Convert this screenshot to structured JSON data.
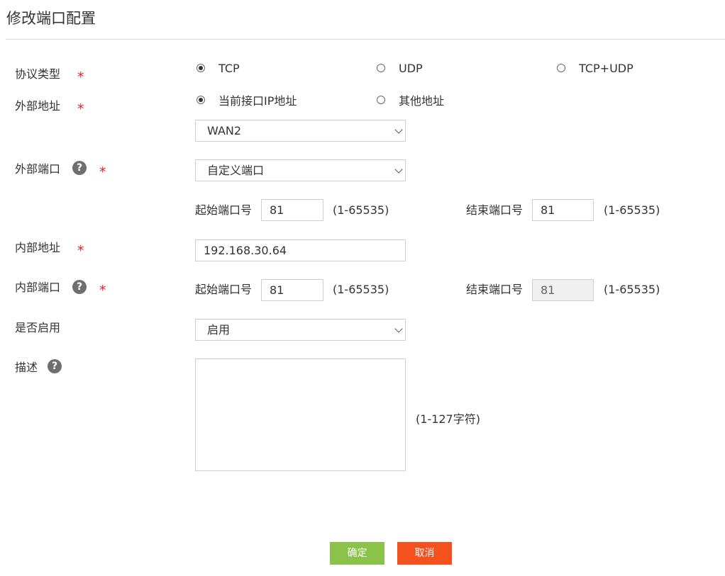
{
  "page_title": "修改端口配置",
  "required_mark": "*",
  "help_glyph": "?",
  "protocol": {
    "label": "协议类型",
    "options": [
      {
        "label": "TCP",
        "selected": true
      },
      {
        "label": "UDP",
        "selected": false
      },
      {
        "label": "TCP+UDP",
        "selected": false
      }
    ]
  },
  "external_address": {
    "label": "外部地址",
    "options": [
      {
        "label": "当前接口IP地址",
        "selected": true
      },
      {
        "label": "其他地址",
        "selected": false
      }
    ],
    "interface_select": "WAN2"
  },
  "external_port": {
    "label": "外部端口",
    "mode_select": "自定义端口",
    "start_label": "起始端口号",
    "start_value": "81",
    "start_range": "(1-65535)",
    "end_label": "结束端口号",
    "end_value": "81",
    "end_range": "(1-65535)"
  },
  "internal_address": {
    "label": "内部地址",
    "value": "192.168.30.64"
  },
  "internal_port": {
    "label": "内部端口",
    "start_label": "起始端口号",
    "start_value": "81",
    "start_range": "(1-65535)",
    "end_label": "结束端口号",
    "end_value": "81",
    "end_range": "(1-65535)"
  },
  "enable": {
    "label": "是否启用",
    "select": "启用"
  },
  "description": {
    "label": "描述",
    "value": "",
    "range": "(1-127字符)"
  },
  "buttons": {
    "ok": "确定",
    "cancel": "取消"
  },
  "colors": {
    "required": "#e02020",
    "ok_button": "#8bc34a",
    "cancel_button": "#f4511e"
  }
}
